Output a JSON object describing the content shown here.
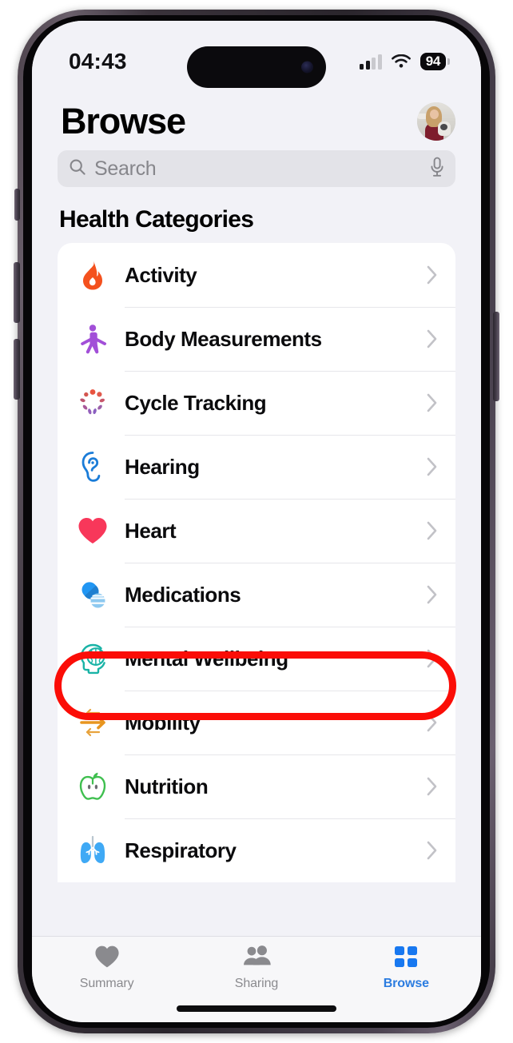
{
  "status_bar": {
    "time": "04:43",
    "signal_icon": "cellular-signal-icon",
    "signal_bars_active": 2,
    "signal_bars_total": 4,
    "wifi_icon": "wifi-icon",
    "battery_percent": "94"
  },
  "header": {
    "title": "Browse",
    "avatar_name": "profile-avatar"
  },
  "search": {
    "placeholder": "Search",
    "value": "",
    "search_icon": "search-icon",
    "mic_icon": "microphone-icon"
  },
  "section": {
    "title": "Health Categories"
  },
  "categories": [
    {
      "label": "Activity",
      "icon": "flame-icon",
      "color": "#f4511e"
    },
    {
      "label": "Body Measurements",
      "icon": "body-figure-icon",
      "color": "#a24fd8"
    },
    {
      "label": "Cycle Tracking",
      "icon": "cycle-burst-icon",
      "color": "#e8533f"
    },
    {
      "label": "Hearing",
      "icon": "ear-icon",
      "color": "#1a7cd8"
    },
    {
      "label": "Heart",
      "icon": "heart-icon",
      "color": "#f8375a"
    },
    {
      "label": "Medications",
      "icon": "pills-icon",
      "color": "#2196f3"
    },
    {
      "label": "Mental Wellbeing",
      "icon": "brain-head-icon",
      "color": "#19b3a6"
    },
    {
      "label": "Mobility",
      "icon": "arrows-icon",
      "color": "#e8a33d"
    },
    {
      "label": "Nutrition",
      "icon": "apple-icon",
      "color": "#3fbf4f"
    },
    {
      "label": "Respiratory",
      "icon": "lungs-icon",
      "color": "#3fa9f5"
    }
  ],
  "annotation": {
    "target": "Mental Wellbeing",
    "shape": "rounded-rectangle-highlight",
    "color": "#fb0d07"
  },
  "tabbar": {
    "items": [
      {
        "label": "Summary",
        "icon": "heart-icon",
        "active": false
      },
      {
        "label": "Sharing",
        "icon": "people-icon",
        "active": false
      },
      {
        "label": "Browse",
        "icon": "grid-icon",
        "active": true
      }
    ],
    "active_color": "#2b7ce0",
    "inactive_color": "#8a8a8e"
  }
}
